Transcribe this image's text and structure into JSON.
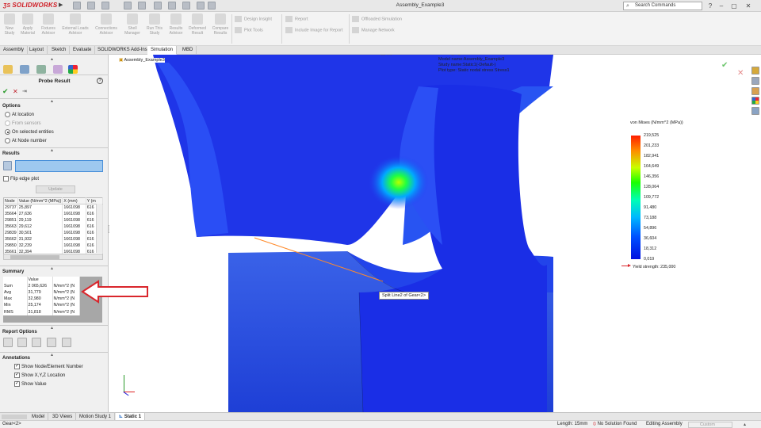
{
  "app": {
    "brand": "SOLIDWORKS",
    "doc_title": "Assembly_Example3",
    "search_placeholder": "Search Commands"
  },
  "ribbon": {
    "big": [
      {
        "l1": "New",
        "l2": "Study"
      },
      {
        "l1": "Apply",
        "l2": "Material"
      },
      {
        "l1": "Fixtures",
        "l2": "Advisor"
      },
      {
        "l1": "External Loads",
        "l2": "Advisor"
      },
      {
        "l1": "Connections",
        "l2": "Advisor"
      },
      {
        "l1": "Shell",
        "l2": "Manager"
      },
      {
        "l1": "Run This",
        "l2": "Study"
      },
      {
        "l1": "Results",
        "l2": "Advisor"
      },
      {
        "l1": "Deformed",
        "l2": "Result"
      },
      {
        "l1": "Compare",
        "l2": "Results"
      }
    ],
    "small": [
      "Design Insight",
      "Plot Tools",
      "Report",
      "Include Image for Report",
      "Offloaded Simulation",
      "Manage Network"
    ]
  },
  "tabs": [
    "Assembly",
    "Layout",
    "Sketch",
    "Evaluate",
    "SOLIDWORKS Add-Ins",
    "Simulation",
    "MBD"
  ],
  "probe": {
    "title": "Probe Result",
    "options_label": "Options",
    "opt_location": "At location",
    "opt_sensors": "From sensors",
    "opt_entities": "On selected entities",
    "opt_node": "At Node number",
    "results_label": "Results",
    "flip_label": "Flip edge plot",
    "update_label": "Update",
    "table_headers": [
      "Node",
      "Value (N/mm^2 (MPa))",
      "X (mm)",
      "Y (m"
    ],
    "rows": [
      [
        "29737",
        "25,897",
        "1661098",
        "616"
      ],
      [
        "35664",
        "27,636",
        "1661098",
        "616"
      ],
      [
        "29851",
        "29,119",
        "1661098",
        "616"
      ],
      [
        "35663",
        "29,612",
        "1661098",
        "616"
      ],
      [
        "29839",
        "30,501",
        "1661098",
        "616"
      ],
      [
        "35662",
        "31,932",
        "1661098",
        "616"
      ],
      [
        "29850",
        "32,239",
        "1661098",
        "616"
      ],
      [
        "35661",
        "32,394",
        "1661098",
        "616"
      ]
    ],
    "summary_label": "Summary",
    "summary_header": "Value",
    "summary": [
      {
        "k": "Sum",
        "v": "2 065,626",
        "u": "N/mm^2 (N"
      },
      {
        "k": "Avg",
        "v": "31,779",
        "u": "N/mm^2 (N"
      },
      {
        "k": "Max",
        "v": "32,980",
        "u": "N/mm^2 (N"
      },
      {
        "k": "Min",
        "v": "25,174",
        "u": "N/mm^2 (N"
      },
      {
        "k": "RMS",
        "v": "31,818",
        "u": "N/mm^2 (N"
      }
    ],
    "report_label": "Report Options",
    "annotations_label": "Annotations",
    "ann_node": "Show Node/Element Number",
    "ann_xyz": "Show X,Y,Z Location",
    "ann_value": "Show Value"
  },
  "viewport": {
    "tree_item": "Assembly_Example3",
    "info_model": "Model name:Assembly_Example3",
    "info_study": "Study name:Static1(-Default-)",
    "info_plot": "Plot type: Static nodal stress Stress1",
    "legend_title": "von Mises (N/mm^2 (MPa))",
    "legend_values": [
      "219,525",
      "201,233",
      "182,941",
      "164,649",
      "146,356",
      "128,064",
      "109,772",
      "91,480",
      "73,188",
      "54,896",
      "36,604",
      "18,312",
      "0,019"
    ],
    "yield_label": "Yield strength: 235,000",
    "tooltip": "Split Line2 of Gear<2>"
  },
  "bottom_tabs": [
    "Model",
    "3D Views",
    "Motion Study 1",
    "Static 1"
  ],
  "status": {
    "left": "Gear<2>",
    "length": "Length: 15mm",
    "solution": "No Solution Found",
    "mode": "Editing Assembly",
    "custom": "Custom"
  },
  "colors": {
    "accent": "#d01e26",
    "stress_low": "#0010e0",
    "stress_high": "#ff1e00",
    "arrow": "#d9262c"
  }
}
